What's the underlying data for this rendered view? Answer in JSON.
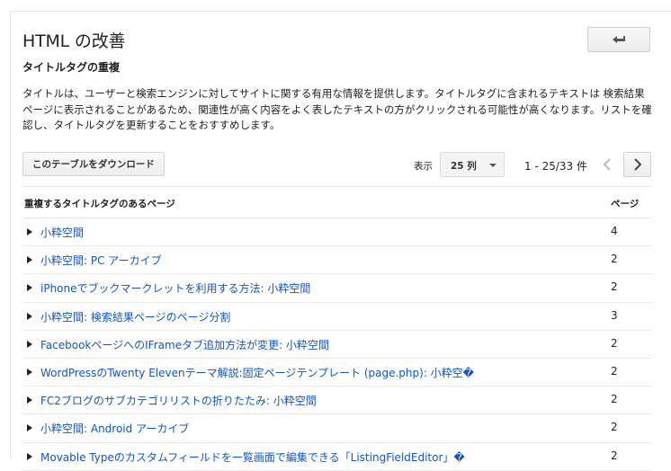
{
  "page": {
    "title": "HTML の改善",
    "back_icon": "back-arrow-icon",
    "subtitle": "タイトルタグの重複",
    "description": "タイトルは、ユーザーと検索エンジンに対してサイトに関する有用な情報を提供します。タイトルタグに含まれるテキストは 検索結果ページに表示されることがあるため、関連性が高く内容をよく表したテキストの方がクリックされる可能性が高くなります。リストを確認し、タイトルタグを更新することをおすすめします。"
  },
  "toolbar": {
    "download_label": "このテーブルをダウンロード",
    "show_label": "表示",
    "rows_select": "25 列",
    "pager_text": "1 - 25/33 件"
  },
  "table": {
    "headers": [
      "重複するタイトルタグのあるページ",
      "ページ"
    ],
    "rows": [
      {
        "title": "小粋空間",
        "pages": "4"
      },
      {
        "title": "小粋空間: PC アーカイブ",
        "pages": "2"
      },
      {
        "title": "iPhoneでブックマークレットを利用する方法: 小粋空間",
        "pages": "2"
      },
      {
        "title": "小粋空間: 検索結果ページのページ分割",
        "pages": "3"
      },
      {
        "title": "FacebookページへのIFrameタブ追加方法が変更: 小粋空間",
        "pages": "2"
      },
      {
        "title": "WordPressのTwenty Elevenテーマ解説:固定ページテンプレート (page.php): 小粋空�",
        "pages": "2"
      },
      {
        "title": "FC2ブログのサブカテゴリリストの折りたたみ: 小粋空間",
        "pages": "2"
      },
      {
        "title": "小粋空間: Android アーカイブ",
        "pages": "2"
      },
      {
        "title": "Movable Typeのカスタムフィールドを一覧画面で編集できる「ListingFieldEditor」�",
        "pages": "2"
      }
    ]
  },
  "colors": {
    "link": "#1155cc",
    "border": "#e8e8e8"
  }
}
